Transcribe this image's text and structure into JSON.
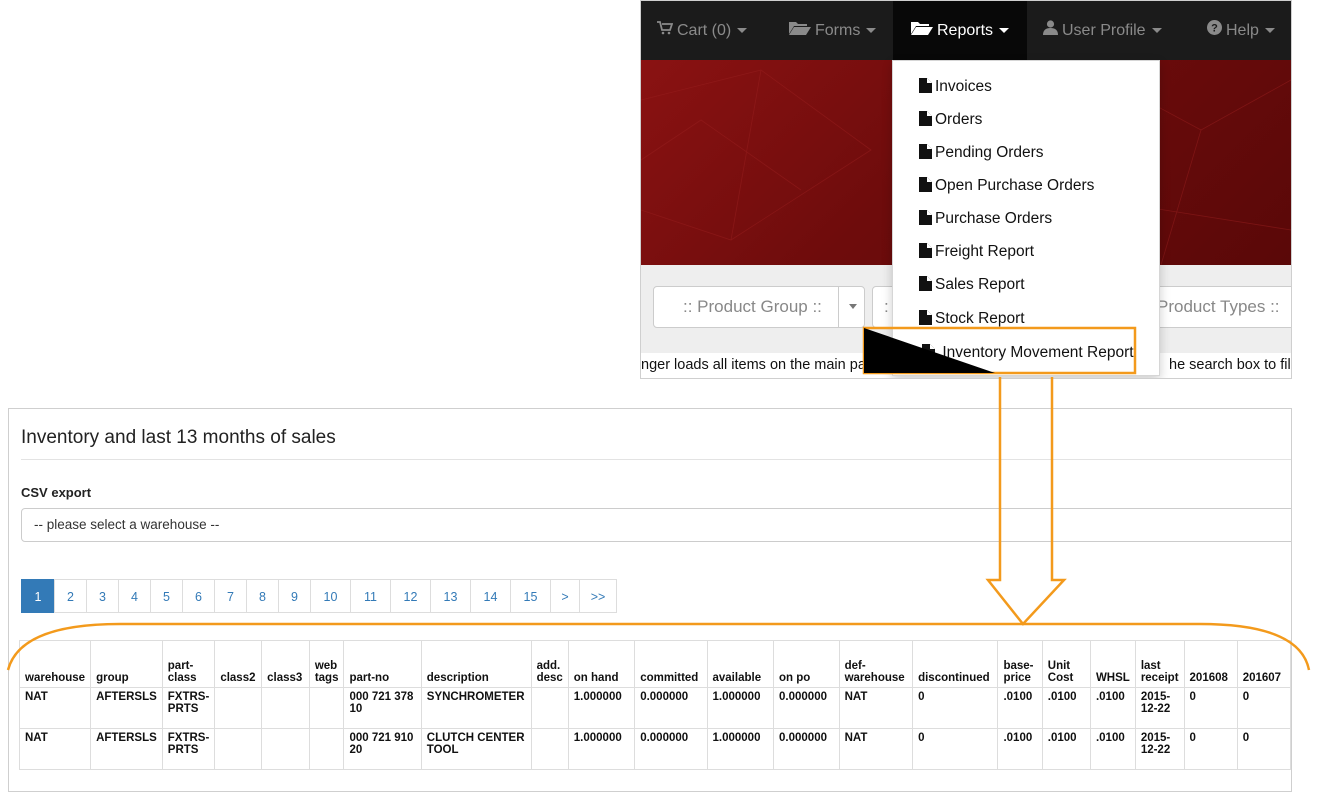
{
  "accent_color": "#f39a1c",
  "navbar": {
    "items": [
      {
        "label": "Cart (0)",
        "icon": "cart-icon"
      },
      {
        "label": "Forms",
        "icon": "folder-open-icon"
      },
      {
        "label": "Reports",
        "icon": "folder-open-icon",
        "active": true
      },
      {
        "label": "User Profile",
        "icon": "user-icon"
      },
      {
        "label": "Help",
        "icon": "question-circle-icon"
      }
    ]
  },
  "reports_menu": {
    "items": [
      "Invoices",
      "Orders",
      "Pending Orders",
      "Open Purchase Orders",
      "Purchase Orders",
      "Freight Report",
      "Sales Report",
      "Stock Report",
      "Inventory Movement Report"
    ],
    "highlighted": "Inventory Movement Report"
  },
  "filters": {
    "product_group": ":: Product Group ::",
    "second_select_fragment": ":",
    "product_types_fragment": "Product Types ::"
  },
  "notice": {
    "left_fragment": "nger loads all items on the main pa",
    "right_fragment": "he search box to fil"
  },
  "report": {
    "title": "Inventory and last 13 months of sales",
    "csv_label": "CSV export",
    "warehouse_placeholder": "-- please select a warehouse --",
    "pagination": [
      "1",
      "2",
      "3",
      "4",
      "5",
      "6",
      "7",
      "8",
      "9",
      "10",
      "11",
      "12",
      "13",
      "14",
      "15",
      ">",
      ">>"
    ],
    "current_page": "1",
    "columns": [
      "warehouse",
      "group",
      "part-class",
      "class2",
      "class3",
      "web tags",
      "part-no",
      "description",
      "add. desc",
      "on hand",
      "committed",
      "available",
      "on po",
      "def-warehouse",
      "discontinued",
      "base-price",
      "Unit Cost",
      "WHSL",
      "last receipt",
      "201608",
      "201607"
    ],
    "rows": [
      [
        "NAT",
        "AFTERSLS",
        "FXTRS-PRTS",
        "",
        "",
        "",
        "000 721 378 10",
        "SYNCHROMETER",
        "",
        "1.000000",
        "0.000000",
        "1.000000",
        "0.000000",
        "NAT",
        "0",
        ".0100",
        ".0100",
        ".0100",
        "2015-12-22",
        "0",
        "0"
      ],
      [
        "NAT",
        "AFTERSLS",
        "FXTRS-PRTS",
        "",
        "",
        "",
        "000 721 910 20",
        "CLUTCH CENTER TOOL",
        "",
        "1.000000",
        "0.000000",
        "1.000000",
        "0.000000",
        "NAT",
        "0",
        ".0100",
        ".0100",
        ".0100",
        "2015-12-22",
        "0",
        "0"
      ]
    ]
  }
}
